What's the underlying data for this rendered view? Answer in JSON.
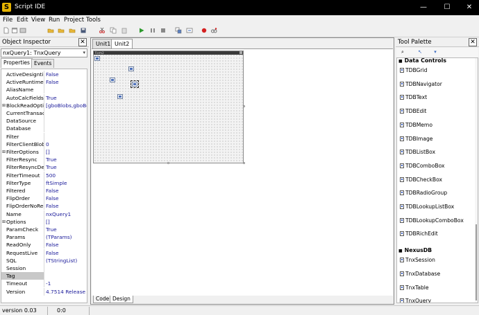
{
  "window": {
    "title": "Script IDE",
    "minimize_glyph": "—",
    "maximize_glyph": "☐",
    "close_glyph": "✕",
    "app_icon": "S"
  },
  "menu": [
    "File",
    "Edit",
    "View",
    "Run",
    "Project",
    "Tools"
  ],
  "toolbar": {
    "groups": [
      [
        "new-file-icon",
        "new-form-icon",
        "open-icon"
      ],
      [
        "open-folder-icon",
        "open-project-icon",
        "save-icon",
        "save-all-icon"
      ],
      [
        "cut-icon",
        "copy-icon",
        "paste-icon"
      ],
      [
        "run-icon",
        "step-icon",
        "stop-icon"
      ],
      [
        "toggle-form-icon",
        "view-unit-icon"
      ],
      [
        "breakpoint-icon",
        "evaluate-icon"
      ]
    ]
  },
  "object_inspector": {
    "title": "Object Inspector",
    "close_glyph": "✕",
    "selected_object": "nxQuery1: TnxQuery",
    "tabs": [
      "Properties",
      "Events"
    ],
    "properties": [
      {
        "name": "ActiveDesigntime",
        "value": "False"
      },
      {
        "name": "ActiveRuntime",
        "value": "False"
      },
      {
        "name": "AliasName",
        "value": ""
      },
      {
        "name": "AutoCalcFields",
        "value": "True"
      },
      {
        "name": "BlockReadOptions",
        "value": "[gboBlobs,gboBookmarks]",
        "expandable": true
      },
      {
        "name": "CurrentTransaction",
        "value": ""
      },
      {
        "name": "DataSource",
        "value": ""
      },
      {
        "name": "Database",
        "value": ""
      },
      {
        "name": "Filter",
        "value": ""
      },
      {
        "name": "FilterClientBlobs",
        "value": "0"
      },
      {
        "name": "FilterOptions",
        "value": "[]",
        "expandable": true
      },
      {
        "name": "FilterResync",
        "value": "True"
      },
      {
        "name": "FilterResyncDelay",
        "value": "True"
      },
      {
        "name": "FilterTimeout",
        "value": "500"
      },
      {
        "name": "FilterType",
        "value": "ftSimple"
      },
      {
        "name": "Filtered",
        "value": "False"
      },
      {
        "name": "FlipOrder",
        "value": "False"
      },
      {
        "name": "FlipOrderNoRecords",
        "value": "False"
      },
      {
        "name": "Name",
        "value": "nxQuery1"
      },
      {
        "name": "Options",
        "value": "[]",
        "expandable": true
      },
      {
        "name": "ParamCheck",
        "value": "True"
      },
      {
        "name": "Params",
        "value": "(TParams)"
      },
      {
        "name": "ReadOnly",
        "value": "False"
      },
      {
        "name": "RequestLive",
        "value": "False"
      },
      {
        "name": "SQL",
        "value": "(TStringList)"
      },
      {
        "name": "Session",
        "value": ""
      },
      {
        "name": "Tag",
        "value": "",
        "selected": true
      },
      {
        "name": "Timeout",
        "value": "-1"
      },
      {
        "name": "Version",
        "value": "4.7514 Release"
      }
    ]
  },
  "editor": {
    "tabs": [
      "Unit1",
      "Unit2"
    ],
    "active_tab": "Unit2",
    "form_caption": "Form2",
    "bottom_tabs": [
      "Code",
      "Design"
    ]
  },
  "tool_palette": {
    "title": "Tool Palette",
    "close_glyph": "✕",
    "header_icons": [
      "filter-icon",
      "cursor-icon",
      "pin-icon"
    ],
    "categories": [
      {
        "name": "Data Controls",
        "items": [
          "TDBGrid",
          "TDBNavigator",
          "TDBText",
          "TDBEdit",
          "TDBMemo",
          "TDBImage",
          "TDBListBox",
          "TDBComboBox",
          "TDBCheckBox",
          "TDBRadioGroup",
          "TDBLookupListBox",
          "TDBLookupComboBox",
          "TDBRichEdit"
        ]
      },
      {
        "name": "NexusDB",
        "items": [
          "TnxSession",
          "TnxDatabase",
          "TnxTable",
          "TnxQuery"
        ]
      }
    ]
  },
  "status_bar": {
    "version": "version 0.03",
    "position": "0:0"
  },
  "colors": {
    "titlebar": "#000000",
    "value_text": "#1a1a9a",
    "selection": "#c8c8c8"
  }
}
